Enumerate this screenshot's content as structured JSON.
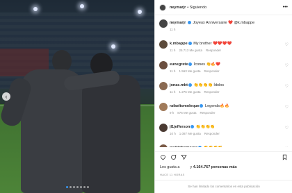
{
  "post": {
    "username": "neymarjr",
    "follow_status": "Siguiendo",
    "caption_user": "neymarjr",
    "caption_text": "Joyeux Anniversaire ❤️ @k.mbappe",
    "caption_time": "11 h"
  },
  "comments": [
    {
      "user": "k.mbappe",
      "text": "My brother ❤️❤️❤️❤️",
      "time": "11 h",
      "likes": "25.713 Me gusta",
      "reply": "Responder",
      "avatar_color": "#5b4a3a"
    },
    {
      "user": "eunegrete",
      "text": "Ícones 👏🔥❤️",
      "time": "11 h",
      "likes": "1.563 Me gusta",
      "reply": "Responder",
      "avatar_color": "#6b4f3f"
    },
    {
      "user": "jonas.mbt",
      "text": "👏👏👏👏 Ídolos",
      "time": "11 h",
      "likes": "1.276 Me gusta",
      "reply": "Responder",
      "avatar_color": "#8a6a52"
    },
    {
      "user": "rafaeltomoleque",
      "text": "Legends🔥🔥",
      "time": "9 h",
      "likes": "876 Me gusta",
      "reply": "Responder",
      "avatar_color": "#a07a5a"
    },
    {
      "user": "jl1jefferson",
      "text": "👏👏👏👏",
      "time": "10 h",
      "likes": "1.087 Me gusta",
      "reply": "Responder",
      "avatar_color": "#4a3a32"
    },
    {
      "user": "pedrinhomoura",
      "text": "👏👏👏👏",
      "time": "",
      "likes": "",
      "reply": "",
      "avatar_color": "#7a5a46"
    }
  ],
  "likes": {
    "prefix": "Les gusta a",
    "suffix": "y",
    "count": "4.164.767 personas más"
  },
  "timestamp": "HACE 11 HORAS",
  "footer_text": "Se han limitado los comentarios en esta publicación",
  "colors": {
    "accent": "#3897f0",
    "heart": "#ed4956",
    "muted": "#8e8e8e"
  }
}
